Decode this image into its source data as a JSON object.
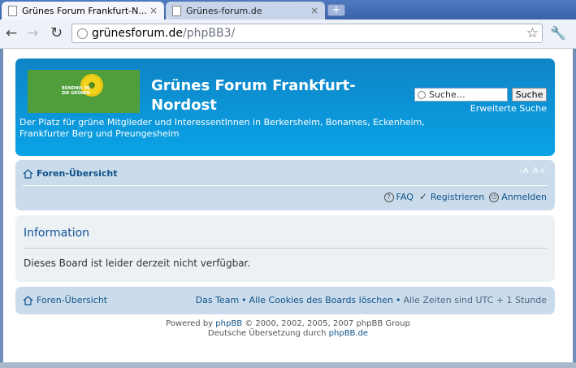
{
  "browser": {
    "tabs": [
      {
        "title": "Grünes Forum Frankfurt-N...",
        "close": "×"
      },
      {
        "title": "Grünes-forum.de",
        "close": "×"
      }
    ],
    "new_tab": "+",
    "url_host": "grünesforum.de",
    "url_path": "/phpBB3/"
  },
  "header": {
    "logo_text_line1": "BÜNDNIS 90",
    "logo_text_line2": "DIE GRÜNEN",
    "site_title": "Grünes Forum Frankfurt-Nordost",
    "site_description": "Der Platz für grüne Mitglieder und InteressentInnen in Berkersheim, Bonames, Eckenheim, Frankfurter Berg und Preungesheim",
    "search_placeholder": "Suche…",
    "search_button": "Suche",
    "advanced_search": "Erweiterte Suche"
  },
  "navbar": {
    "breadcrumb": "Foren-Übersicht",
    "font_size_control": "-A A+",
    "links": {
      "faq": "FAQ",
      "register": "Registrieren",
      "login": "Anmelden"
    }
  },
  "panel": {
    "title": "Information",
    "message": "Dieses Board ist leider derzeit nicht verfügbar."
  },
  "footer": {
    "breadcrumb": "Foren-Übersicht",
    "team": "Das Team",
    "separator": "•",
    "delete_cookies": "Alle Cookies des Boards löschen",
    "timezone": "Alle Zeiten sind UTC + 1 Stunde",
    "powered_by_prefix": "Powered by",
    "phpbb": "phpBB",
    "powered_by_suffix": "© 2000, 2002, 2005, 2007 phpBB Group",
    "translation_prefix": "Deutsche Übersetzung durch",
    "translation_link": "phpBB.de"
  }
}
